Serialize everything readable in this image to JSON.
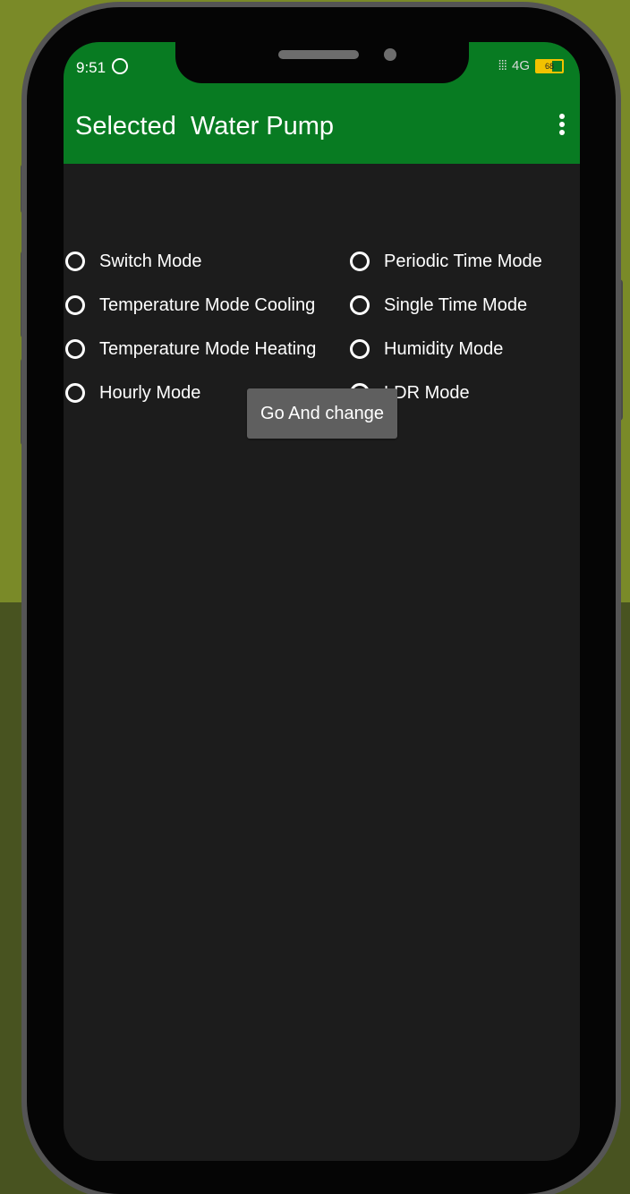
{
  "colors": {
    "background_top": "#7a8a28",
    "background_bottom": "#485320",
    "appbar": "#087b22",
    "screen": "#1c1c1c",
    "button": "#5f5f5f"
  },
  "status_bar": {
    "time": "9:51",
    "network": "4G",
    "battery_level": "68"
  },
  "appbar": {
    "title": "Selected  Water Pump",
    "menu_icon": "more-vert-icon"
  },
  "modes": [
    {
      "label": "Switch Mode"
    },
    {
      "label": "Periodic Time Mode"
    },
    {
      "label": "Temperature Mode Cooling"
    },
    {
      "label": "Single Time Mode"
    },
    {
      "label": "Temperature Mode Heating"
    },
    {
      "label": "Humidity Mode"
    },
    {
      "label": "Hourly Mode"
    },
    {
      "label": "LDR Mode"
    }
  ],
  "action": {
    "button_label": "Go And change"
  }
}
